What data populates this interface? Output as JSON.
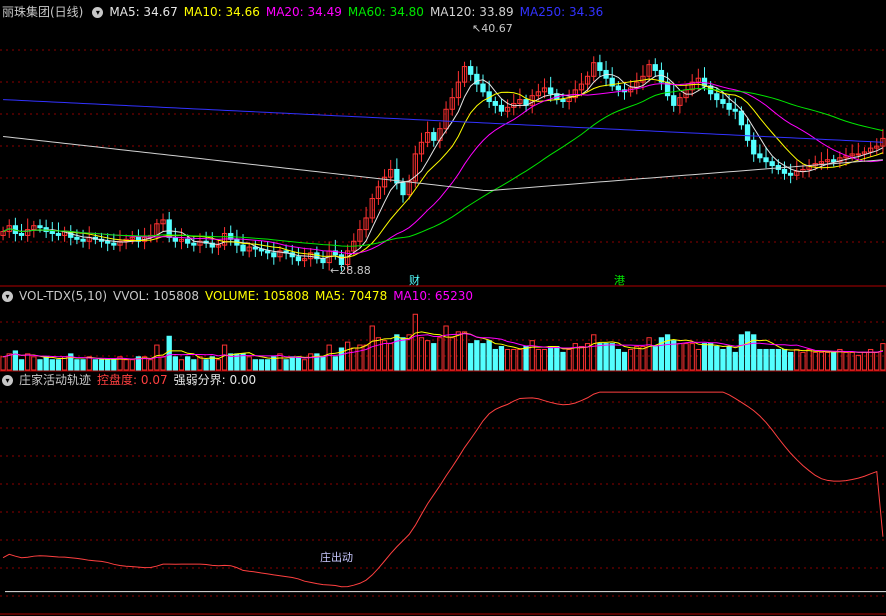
{
  "colors": {
    "up": "#ff3232",
    "down": "#54ffff",
    "ma5": "#e6e6e6",
    "ma10": "#ffff00",
    "ma20": "#ff00ff",
    "ma60": "#00e600",
    "ma120": "#d2d2d2",
    "ma250": "#3232ff",
    "grid": "#8b0000",
    "label": "#c8c8c8"
  },
  "price_panel": {
    "title": "丽珠集团(日线)",
    "ma5": "MA5: 34.67",
    "ma10": "MA10: 34.66",
    "ma20": "MA20: 34.49",
    "ma60": "MA60: 34.80",
    "ma120": "MA120: 33.89",
    "ma250": "MA250: 34.36",
    "high_mark": "40.67",
    "low_mark": "28.88",
    "event_tags": [
      "财",
      "港"
    ]
  },
  "volume_panel": {
    "name": "VOL-TDX(5,10)",
    "vvol": "VVOL: 105808",
    "volume": "VOLUME: 105808",
    "ma5": "MA5: 70478",
    "ma10": "MA10: 65230"
  },
  "indicator_panel": {
    "name": "庄家活动轨迹",
    "kpd": "控盘度: 0.07",
    "qrfj": "强弱分界: 0.00",
    "annotation": "庄出动"
  },
  "chart_data": {
    "type": "candlestick",
    "bars": 144,
    "price_range": [
      28.0,
      41.5
    ],
    "close": [
      30.6,
      30.9,
      30.5,
      30.4,
      30.7,
      30.9,
      30.8,
      30.6,
      30.5,
      30.4,
      30.6,
      30.3,
      30.2,
      30.1,
      30.3,
      30.2,
      30.1,
      30.0,
      29.9,
      30.1,
      30.2,
      30.3,
      30.1,
      30.3,
      30.4,
      31.0,
      31.2,
      30.3,
      30.1,
      30.2,
      30.0,
      29.9,
      30.1,
      30.0,
      29.8,
      29.9,
      30.5,
      30.2,
      29.9,
      29.6,
      29.8,
      29.7,
      29.6,
      29.5,
      29.3,
      29.6,
      29.5,
      29.3,
      29.1,
      29.2,
      29.5,
      29.2,
      29.0,
      29.6,
      29.4,
      28.9,
      29.6,
      30.1,
      30.7,
      31.3,
      32.3,
      32.9,
      33.4,
      33.8,
      33.1,
      32.5,
      33.2,
      34.6,
      35.2,
      35.7,
      35.3,
      35.9,
      36.9,
      37.5,
      38.3,
      39.1,
      38.7,
      38.2,
      37.8,
      37.3,
      37.1,
      36.8,
      37.0,
      37.2,
      37.4,
      37.1,
      37.6,
      37.8,
      38.0,
      37.7,
      37.4,
      37.3,
      37.5,
      37.9,
      38.2,
      38.6,
      39.3,
      38.9,
      38.5,
      38.1,
      37.9,
      37.8,
      38.0,
      38.3,
      38.6,
      39.2,
      38.9,
      38.3,
      37.6,
      37.1,
      37.5,
      37.9,
      38.3,
      38.5,
      38.1,
      37.7,
      37.4,
      37.2,
      36.9,
      36.8,
      36.1,
      35.3,
      34.6,
      34.4,
      34.2,
      34.0,
      33.8,
      33.6,
      33.5,
      33.7,
      33.8,
      34.0,
      34.1,
      34.2,
      34.3,
      34.2,
      34.4,
      34.5,
      34.6,
      34.6,
      34.7,
      34.9,
      35.0,
      35.4
    ],
    "ma250_start": 37.4,
    "ma250_end": 35.2,
    "ma120_start": 35.5,
    "ma120_low": 32.7,
    "ma120_end": 34.3,
    "volume_range": [
      0,
      360000
    ],
    "volume_ma5_last": 70478,
    "volume_ma10_last": 65230,
    "indicator_range": [
      -0.1,
      1.0
    ],
    "indicator_last": 0.07,
    "strength_line": 0.0
  }
}
